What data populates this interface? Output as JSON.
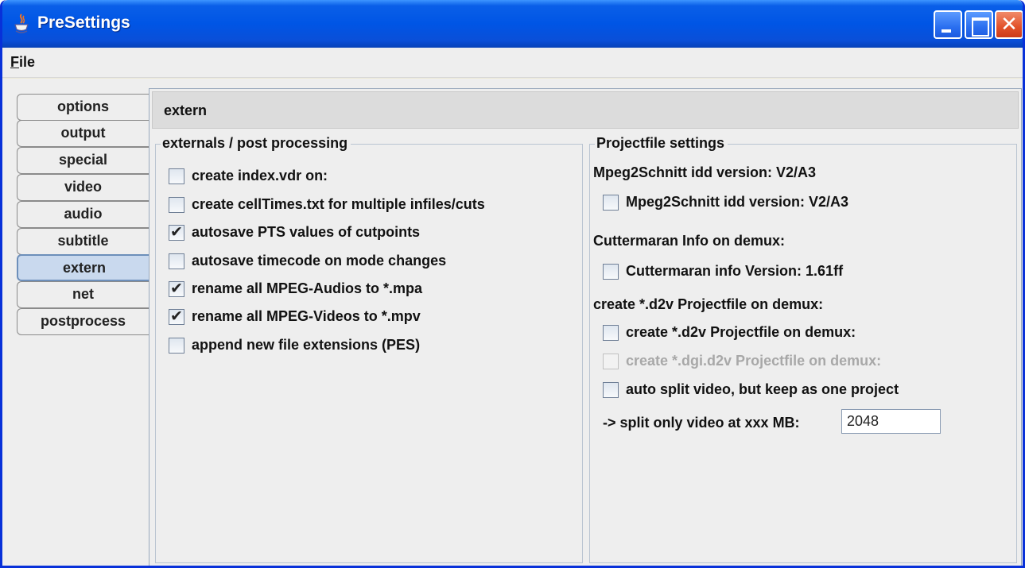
{
  "window": {
    "title": "PreSettings"
  },
  "menu": {
    "file_prefix": "F",
    "file_rest": "ile"
  },
  "tabs": [
    {
      "label": "options",
      "selected": false
    },
    {
      "label": "output",
      "selected": false
    },
    {
      "label": "special",
      "selected": false
    },
    {
      "label": "video",
      "selected": false
    },
    {
      "label": "audio",
      "selected": false
    },
    {
      "label": "subtitle",
      "selected": false
    },
    {
      "label": "extern",
      "selected": true
    },
    {
      "label": "net",
      "selected": false
    },
    {
      "label": "postprocess",
      "selected": false
    }
  ],
  "panel": {
    "header": "extern"
  },
  "externals": {
    "title": "externals / post processing",
    "options": [
      {
        "label": "create index.vdr on:",
        "checked": false,
        "mark": ""
      },
      {
        "label": "create cellTimes.txt for multiple infiles/cuts",
        "checked": false,
        "mark": ""
      },
      {
        "label": "autosave PTS values of cutpoints",
        "checked": true,
        "mark": "✔"
      },
      {
        "label": "autosave timecode on mode changes",
        "checked": false,
        "mark": ""
      },
      {
        "label": "rename all MPEG-Audios to *.mpa",
        "checked": true,
        "mark": "✔"
      },
      {
        "label": "rename all MPEG-Videos to *.mpv",
        "checked": true,
        "mark": "✔"
      },
      {
        "label": "append new file extensions (PES)",
        "checked": false,
        "mark": ""
      }
    ]
  },
  "projectfile": {
    "title": "Projectfile settings",
    "mpeg2schnitt_label": "Mpeg2Schnitt idd version: V2/A3",
    "mpeg2schnitt_checkbox": "Mpeg2Schnitt idd version: V2/A3",
    "cuttermaran_label": "Cuttermaran Info on demux:",
    "cuttermaran_checkbox": "Cuttermaran info Version: 1.61ff",
    "d2v_label": "create *.d2v Projectfile on demux:",
    "d2v_checkbox": "create *.d2v Projectfile on demux:",
    "dgi_checkbox": "create *.dgi.d2v Projectfile on demux:",
    "autosplit_checkbox": "auto split video, but keep as one project",
    "split_label": "-> split only video at xxx MB:",
    "split_value": "2048"
  }
}
